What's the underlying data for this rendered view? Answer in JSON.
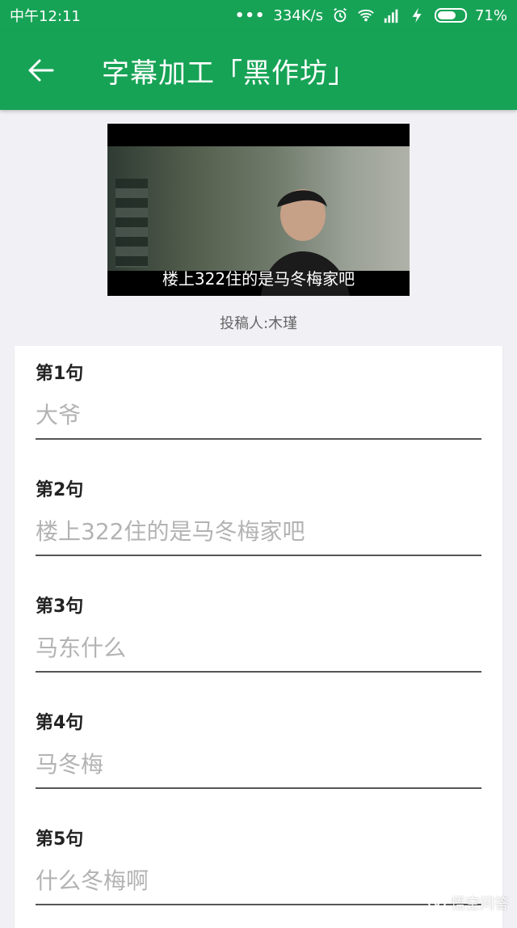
{
  "status": {
    "time": "中午12:11",
    "dots": "•••",
    "speed": "334K/s",
    "battery_percent": "71%",
    "battery_level": 0.71,
    "icons": [
      "alarm-icon",
      "wifi-icon",
      "signal-icon",
      "charging-bolt-icon",
      "battery-icon"
    ]
  },
  "appbar": {
    "title": "字幕加工「黑作坊」",
    "back_icon": "arrow-left-icon"
  },
  "media": {
    "subtitle": "楼上322住的是马冬梅家吧"
  },
  "submitter": "投稿人:木瑾",
  "lines": [
    {
      "label": "第1句",
      "placeholder": "大爷"
    },
    {
      "label": "第2句",
      "placeholder": "楼上322住的是马冬梅家吧"
    },
    {
      "label": "第3句",
      "placeholder": "马东什么"
    },
    {
      "label": "第4句",
      "placeholder": "马冬梅"
    },
    {
      "label": "第5句",
      "placeholder": "什么冬梅啊"
    }
  ],
  "watermark": "悟空问答",
  "colors": {
    "primary": "#17a356",
    "background": "#f1f0f5"
  }
}
